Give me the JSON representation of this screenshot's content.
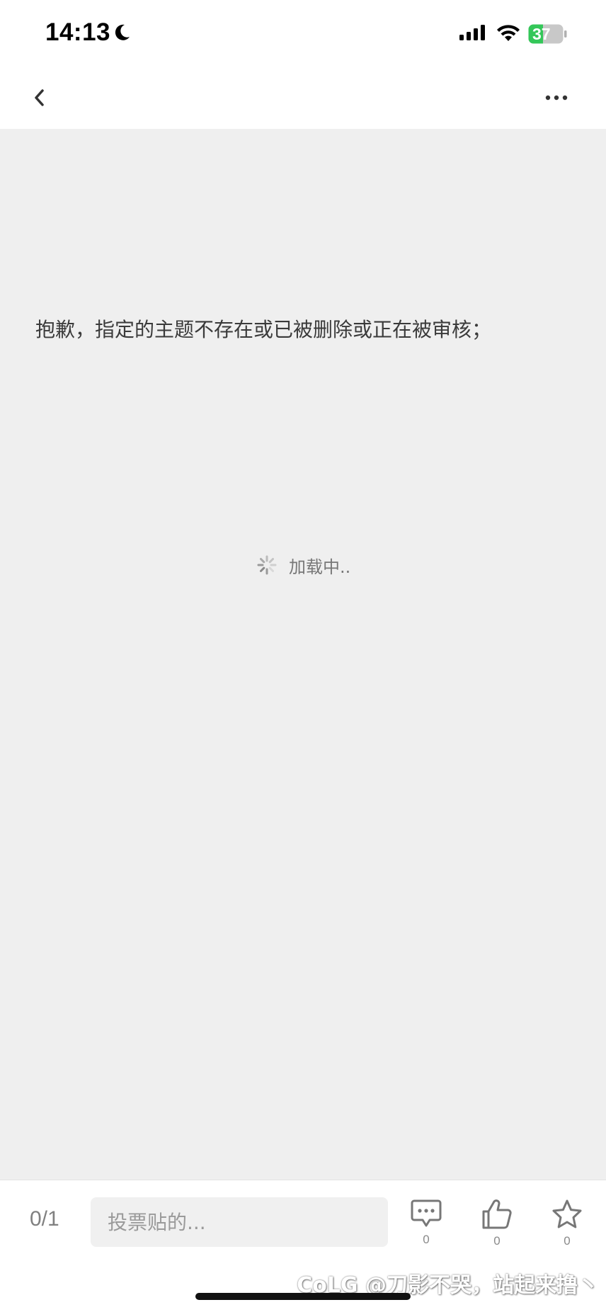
{
  "status_bar": {
    "time": "14:13",
    "battery_level": "37",
    "battery_color": "#34c759"
  },
  "nav": {
    "back_icon": "chevron-left-icon",
    "more_icon": "ellipsis-horizontal-icon"
  },
  "content": {
    "error_message": "抱歉，指定的主题不存在或已被删除或正在被审核；",
    "loading_text": "加载中.."
  },
  "bottom_bar": {
    "page_counter": "0/1",
    "reply_placeholder": "投票贴的...",
    "comments_count": "0",
    "likes_count": "0",
    "favorites_count": "0"
  },
  "watermark": {
    "text": "CoLG @刀影不哭，站起来撸丶"
  }
}
